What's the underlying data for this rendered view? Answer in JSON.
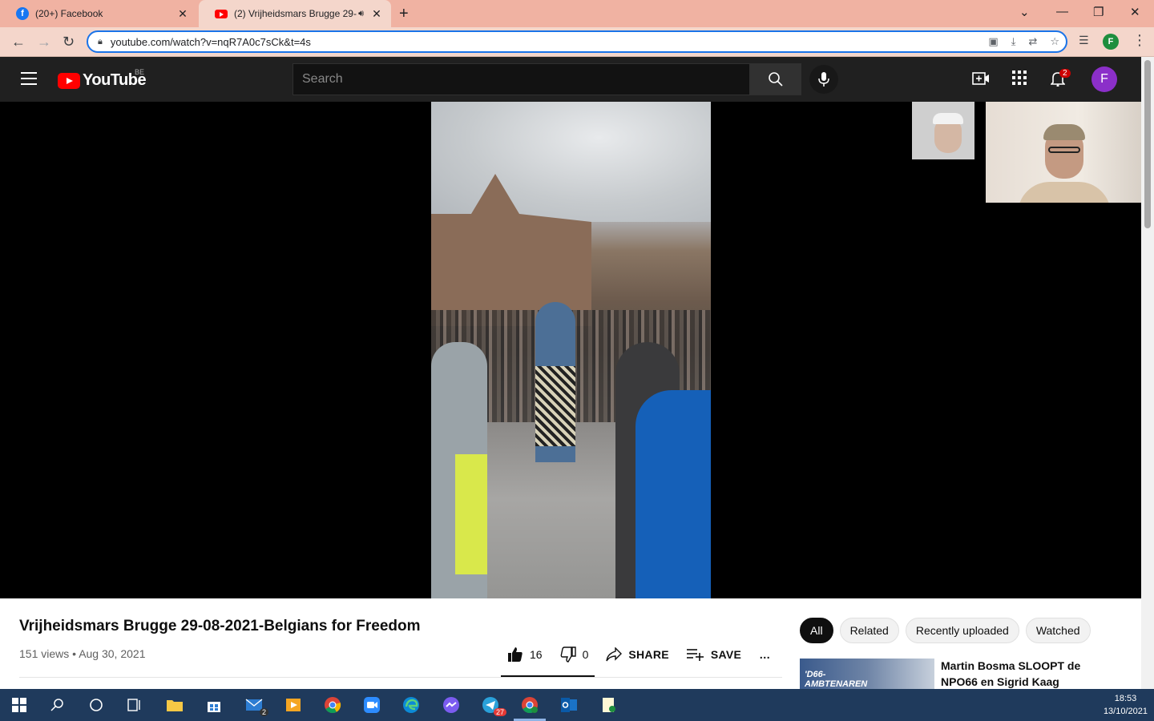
{
  "browser": {
    "tabs": [
      {
        "title": "(20+) Facebook",
        "favicon": "facebook-icon",
        "active": false
      },
      {
        "title": "(2) Vrijheidsmars Brugge 29-",
        "favicon": "youtube-icon",
        "active": true,
        "audio": true
      }
    ],
    "url": "youtube.com/watch?v=nqR7A0c7sCk&t=4s",
    "profile_letter": "F"
  },
  "youtube": {
    "logo_text": "YouTube",
    "country_code": "BE",
    "search_placeholder": "Search",
    "notification_count": "2",
    "avatar_letter": "F",
    "avatar_color": "#8b2fc9"
  },
  "video": {
    "title": "Vrijheidsmars Brugge 29-08-2021-Belgians for Freedom",
    "views": "151 views",
    "date": "Aug 30, 2021",
    "meta_separator": "•",
    "likes": "16",
    "dislikes": "0",
    "share_label": "SHARE",
    "save_label": "SAVE",
    "more_label": "…"
  },
  "sidebar": {
    "chips": [
      "All",
      "Related",
      "Recently uploaded",
      "Watched"
    ],
    "active_chip": "All",
    "recommendation": {
      "title": "Martin Bosma SLOOPT de NPO66 en Sigrid Kaag",
      "thumb_text": "'D66-\nAMBTENAREN"
    }
  },
  "taskbar": {
    "time": "18:53",
    "date": "13/10/2021",
    "mail_badge": "2",
    "chat_badge": "27"
  }
}
